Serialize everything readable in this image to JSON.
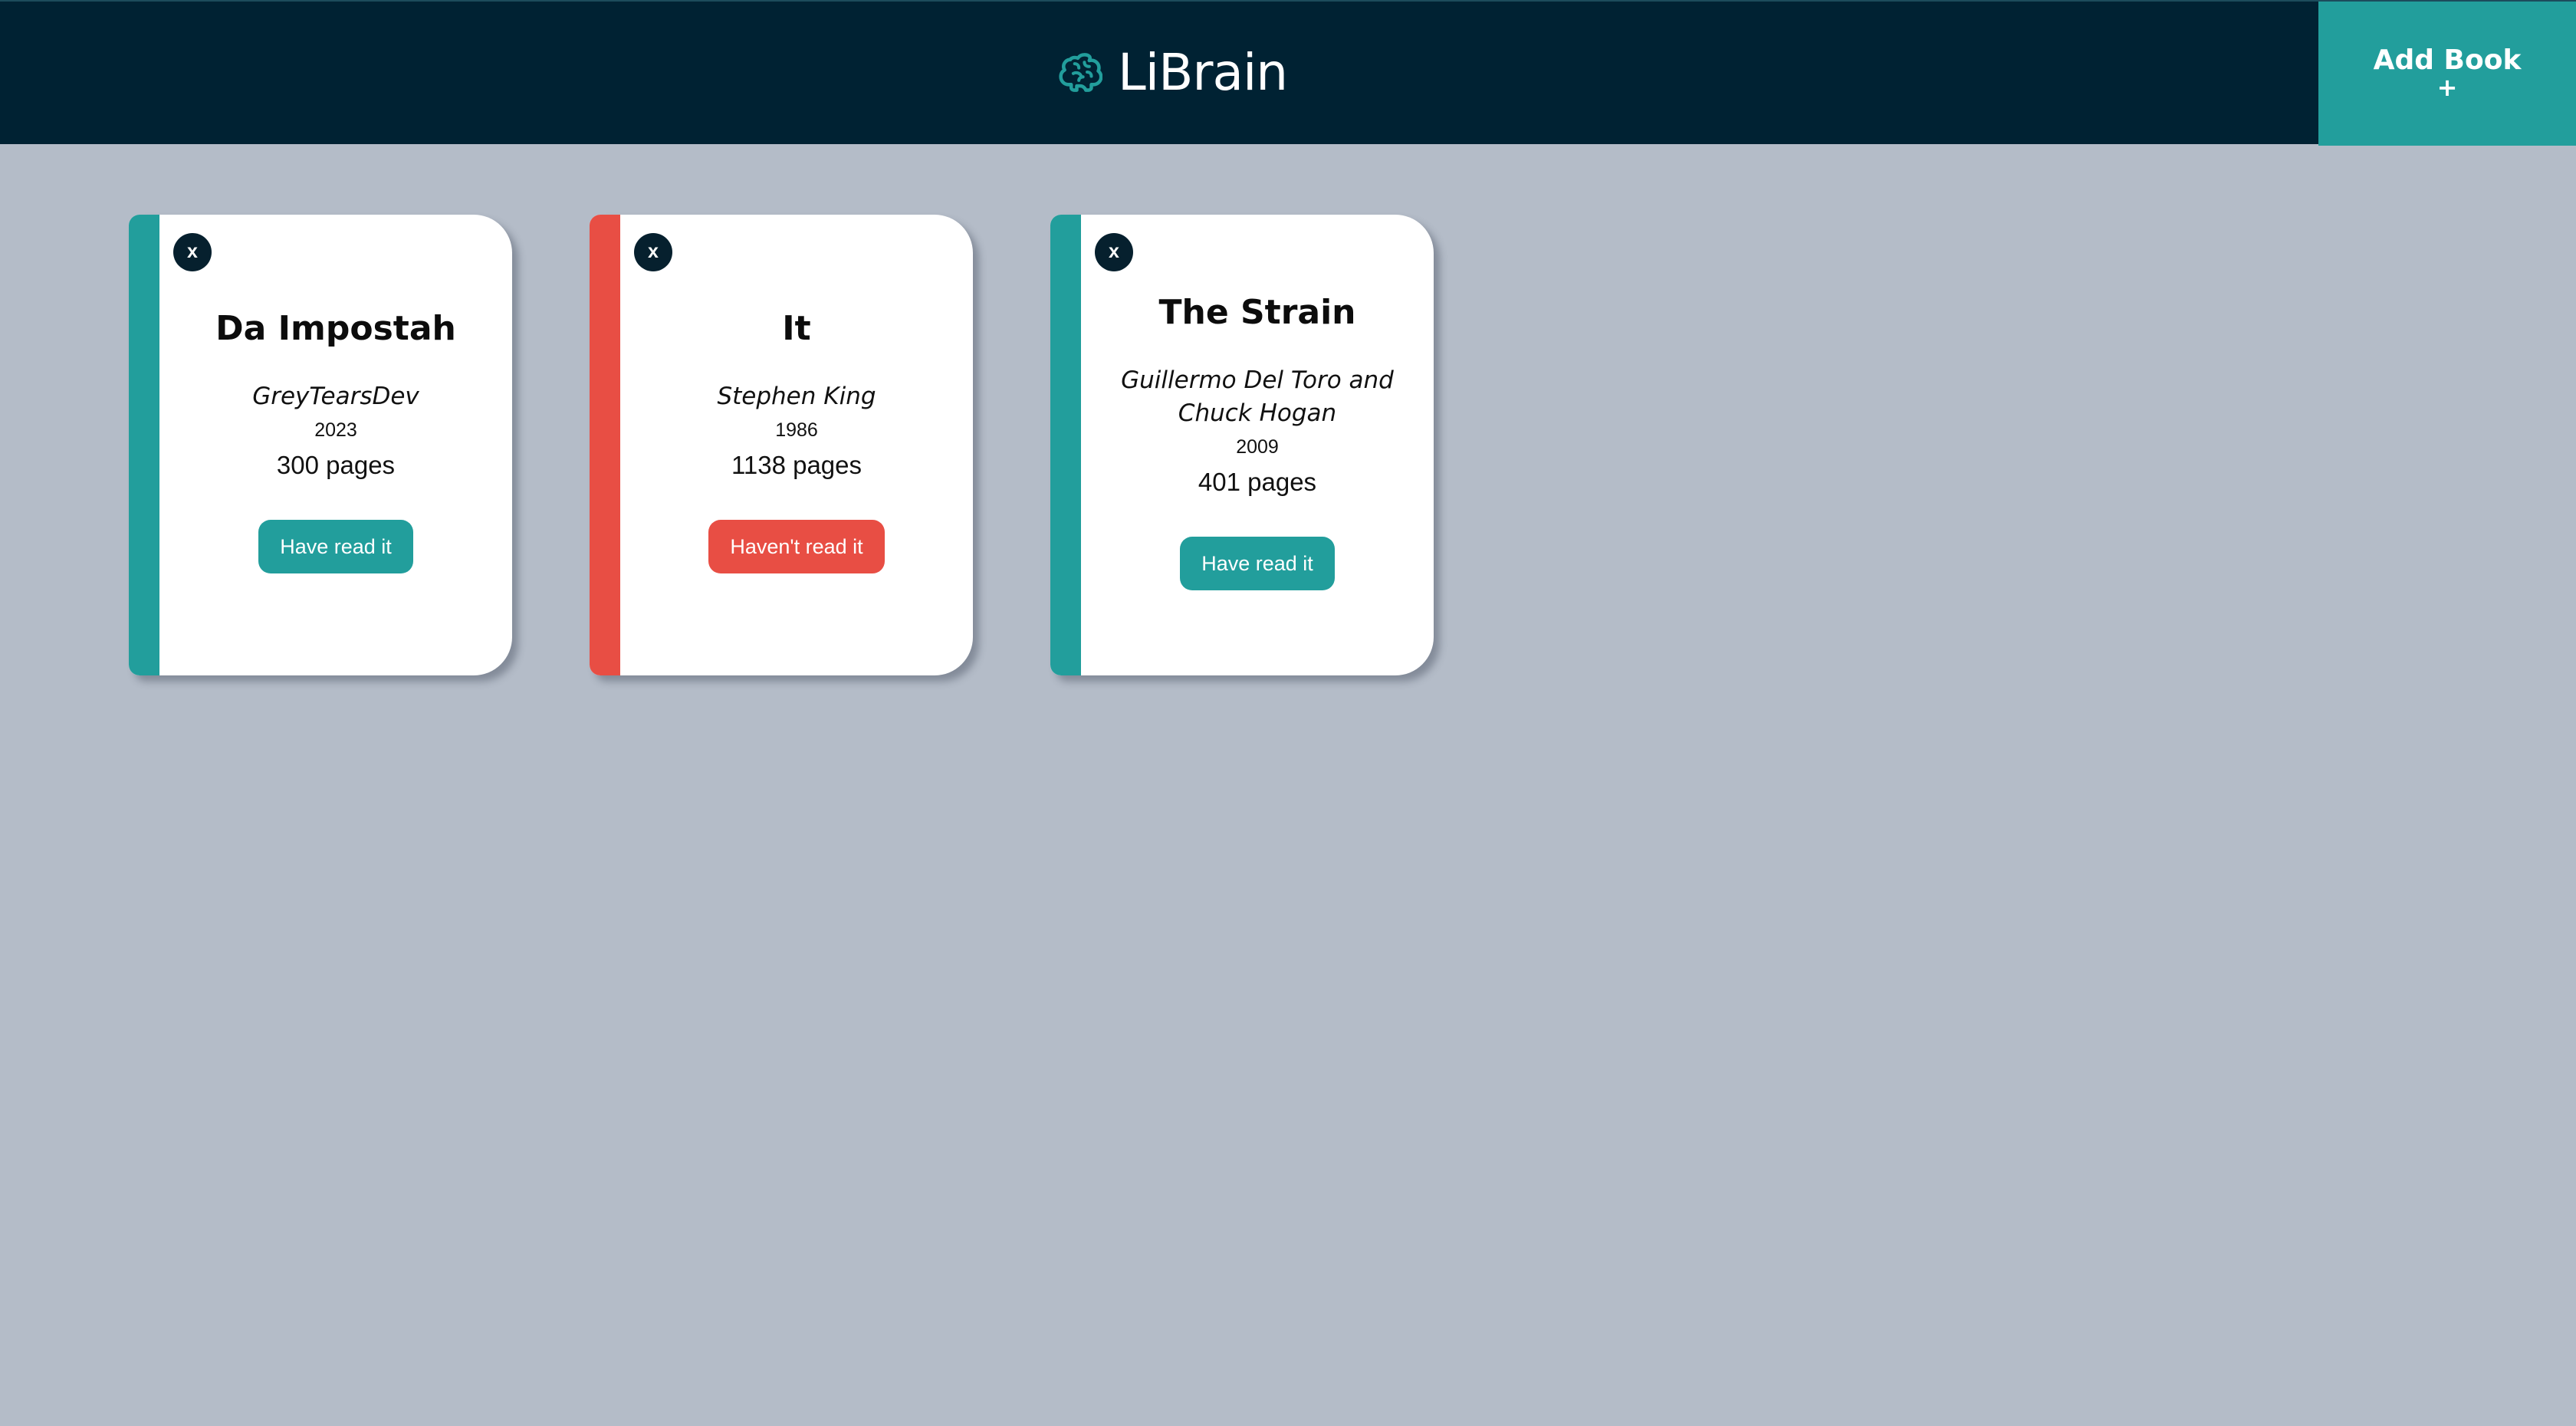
{
  "header": {
    "brand_name": "LiBrain",
    "brand_icon": "brain-icon",
    "add_book_label": "Add Book",
    "add_book_plus": "+"
  },
  "colors": {
    "header_bg": "#002233",
    "accent_read": "#229e9c",
    "accent_unread": "#e84e44",
    "page_bg": "#b4bcc8"
  },
  "books": [
    {
      "close_label": "x",
      "title": "Da Impostah",
      "author": "GreyTearsDev",
      "year": "2023",
      "pages": "300 pages",
      "status": "Have read it",
      "read": true
    },
    {
      "close_label": "x",
      "title": "It",
      "author": "Stephen King",
      "year": "1986",
      "pages": "1138 pages",
      "status": "Haven't read it",
      "read": false
    },
    {
      "close_label": "x",
      "title": "The Strain",
      "author": "Guillermo Del Toro and Chuck Hogan",
      "year": "2009",
      "pages": "401 pages",
      "status": "Have read it",
      "read": true
    }
  ]
}
